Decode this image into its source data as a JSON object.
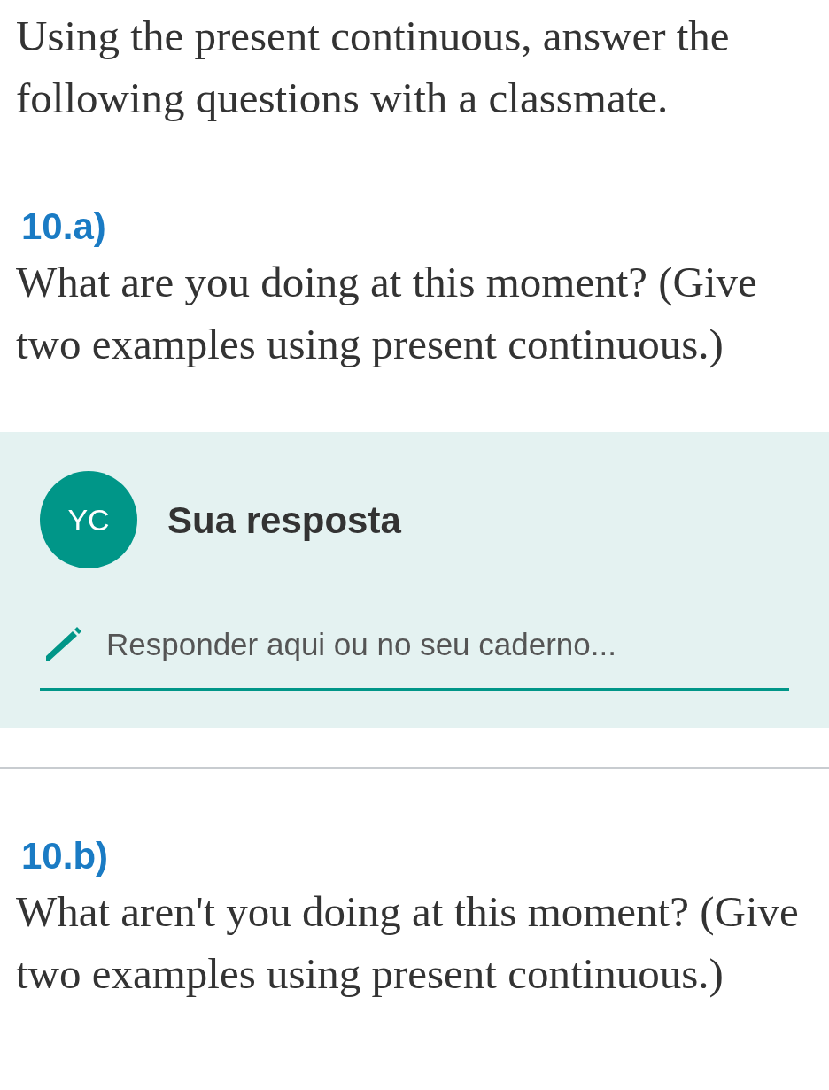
{
  "intro": "Using the present continuous, answer the following questions with a classmate.",
  "questions": [
    {
      "number": "10.a)",
      "text": "What are you doing at this moment? (Give two examples using present continuous.)",
      "answer": {
        "avatar": "YC",
        "title": "Sua resposta",
        "placeholder": "Responder aqui ou no seu caderno..."
      }
    },
    {
      "number": "10.b)",
      "text": "What aren't you doing at this moment? (Give two examples using present continuous.)"
    }
  ]
}
